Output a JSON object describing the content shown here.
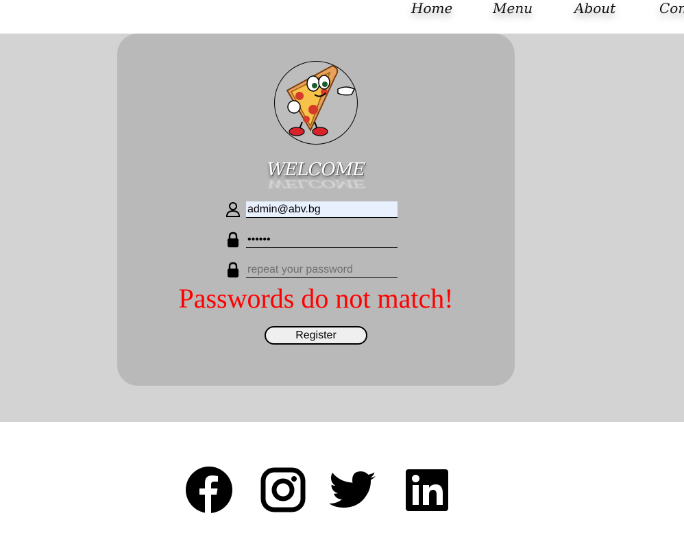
{
  "nav": {
    "home": "Home",
    "menu": "Menu",
    "about": "About",
    "contact": "Cont"
  },
  "form": {
    "welcome": "WELCOME",
    "email_value": "admin@abv.bg",
    "password_value": "••••••",
    "repeat_placeholder": "repeat your password",
    "error": "Passwords do not match!",
    "register_label": "Register"
  },
  "icons": {
    "logo": "pizza-mascot-logo",
    "email": "user-icon",
    "password": "lock-icon",
    "repeat": "lock-icon"
  },
  "social": [
    "facebook-icon",
    "instagram-icon",
    "twitter-icon",
    "linkedin-icon"
  ],
  "colors": {
    "band": "#d3d3d3",
    "card": "#b9b9b9",
    "error": "#ff0000",
    "autofill": "#e8f0fe"
  }
}
